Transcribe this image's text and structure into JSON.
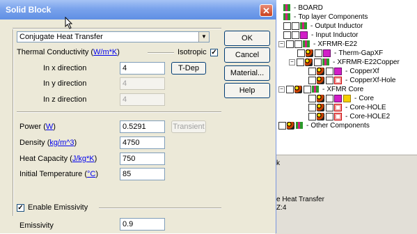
{
  "dialog": {
    "title": "Solid Block",
    "close_glyph": "✕",
    "type_select": {
      "value": "Conjugate Heat Transfer"
    },
    "thermal": {
      "label_prefix": "Thermal Conductivity (",
      "label_unit": "W/m*K",
      "label_suffix": ")",
      "isotropic_label": "Isotropic",
      "isotropic_checked": true,
      "x_label": "In  x  direction",
      "y_label": "In  y  direction",
      "z_label": "In  z  direction",
      "x_value": "4",
      "y_value": "4",
      "z_value": "4",
      "tdep_label": "T-Dep"
    },
    "power": {
      "label": "Power (",
      "unit": "W",
      "suffix": ")",
      "value": "0.5291",
      "transient_label": "Transient"
    },
    "density": {
      "label": "Density (",
      "unit": "kg/m^3",
      "suffix": ")",
      "value": "4750"
    },
    "heat_capacity": {
      "label": "Heat Capacity (",
      "unit": "J/kg*K",
      "suffix": ")",
      "value": "750"
    },
    "initial_temp": {
      "label": "Initial Temperature (",
      "unit": "°C",
      "suffix": ")",
      "value": "85"
    },
    "emissivity": {
      "enable_label": "Enable Emissivity",
      "enabled": true,
      "label": "Emissivity",
      "value": "0.9"
    },
    "buttons": {
      "ok": "OK",
      "cancel": "Cancel",
      "material": "Material...",
      "help": "Help"
    },
    "check_glyph": "✓"
  },
  "tree": {
    "dash": "-",
    "nodes": [
      {
        "label": "BOARD"
      },
      {
        "label": "Top layer Components"
      },
      {
        "label": "Output Inductor"
      },
      {
        "label": "Input Inductor"
      },
      {
        "label": "XFRMR-E22"
      },
      {
        "label": "Therm-GapXF"
      },
      {
        "label": "XFRMR-E22Copper"
      },
      {
        "label": "CopperXf"
      },
      {
        "label": "CopperXf-Hole"
      },
      {
        "label": "XFMR Core"
      },
      {
        "label": "Core"
      },
      {
        "label": "Core-HOLE"
      },
      {
        "label": "Core-HOLE2"
      },
      {
        "label": "Other Components"
      }
    ],
    "expander_minus": "−"
  },
  "lower_panel": {
    "text1": "k",
    "text2": "e Heat Transfer",
    "text3": "Z:4"
  }
}
